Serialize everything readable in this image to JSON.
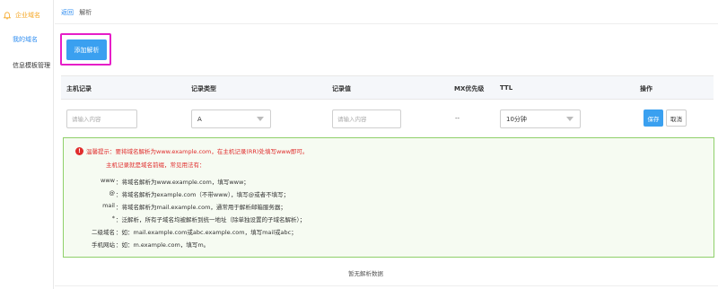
{
  "sidebar": {
    "items": [
      {
        "label": "企业域名",
        "active": true,
        "icon": "bell-icon"
      },
      {
        "label": "我的域名",
        "active": false
      },
      {
        "label": "信息模板管理",
        "active": false
      }
    ]
  },
  "breadcrumb": {
    "back": "返回",
    "current": "解析"
  },
  "toolbar": {
    "add_label": "添加解析"
  },
  "table": {
    "headers": [
      "主机记录",
      "记录类型",
      "记录值",
      "MX优先级",
      "TTL",
      "操作"
    ],
    "edit_row": {
      "host_placeholder": "请输入内容",
      "type_value": "A",
      "value_placeholder": "请输入内容",
      "mx_value": "--",
      "ttl_value": "10分钟",
      "save_label": "保存",
      "cancel_label": "取消"
    },
    "empty_text": "暂无解析数据"
  },
  "tips": {
    "warn_symbol": "!",
    "line1": "温馨提示：要将域名解析为www.example.com，在主机记录(RR)处填写www即可。",
    "line2": "主机记录就是域名前缀，常见用法有：",
    "examples": [
      {
        "key": "www",
        "desc": "：将域名解析为www.example.com，填写www；"
      },
      {
        "key": "@",
        "desc": "：将域名解析为example.com（不带www），填写@或者不填写；"
      },
      {
        "key": "mail",
        "desc": "：将域名解析为mail.example.com，通常用于解析邮箱服务器；"
      },
      {
        "key": "*",
        "desc": "：泛解析，所有子域名均被解析到统一地址（除单独设置的子域名解析）；"
      },
      {
        "key": "二级域名",
        "desc": "：如：mail.example.com或abc.example.com，填写mail或abc；"
      },
      {
        "key": "手机网站",
        "desc": "：如：m.example.com，填写m。"
      }
    ]
  },
  "colors": {
    "accent": "#3aa0f0",
    "highlight_border": "#e61ec8",
    "active_sidebar": "#f5a623",
    "tip_red": "#e02d2d",
    "tip_border": "#8fd06a"
  }
}
